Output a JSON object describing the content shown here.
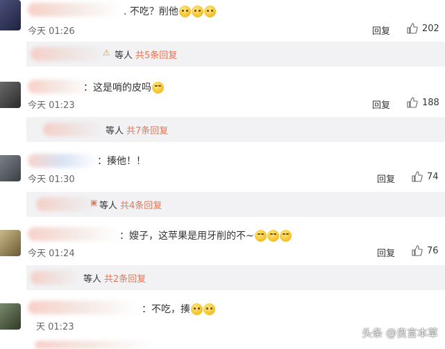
{
  "comments": [
    {
      "text": ". 不吃？削他",
      "emoji_count": 3,
      "time": "今天 01:26",
      "reply_label": "回复",
      "likes": "202",
      "replies_deng": "等人",
      "replies_count": "共5条回复"
    },
    {
      "text": "：这是哨的皮吗",
      "emoji_count": 1,
      "time": "今天 01:23",
      "reply_label": "回复",
      "likes": "188",
      "replies_deng": "等人",
      "replies_count": "共7条回复"
    },
    {
      "text": "：揍他！！",
      "emoji_count": 0,
      "time": "今天 01:30",
      "reply_label": "回复",
      "likes": "74",
      "replies_deng": "等人",
      "replies_count": "共4条回复"
    },
    {
      "text": "：嫂子，这苹果是用牙削的不~",
      "emoji_count": 3,
      "time": "今天 01:24",
      "reply_label": "回复",
      "likes": "76",
      "replies_deng": "等人",
      "replies_count": "共2条回复"
    },
    {
      "text": "：不吃，揍",
      "emoji_count": 2,
      "time": "天 01:23",
      "reply_label": "",
      "likes": ""
    }
  ],
  "watermark": "头条 @良言本草",
  "icons": {
    "like": "thumbs-up-icon",
    "emoji": "emoji-icon"
  },
  "colors": {
    "reply_count": "#eb7350",
    "replies_bg": "#f2f2f5"
  }
}
